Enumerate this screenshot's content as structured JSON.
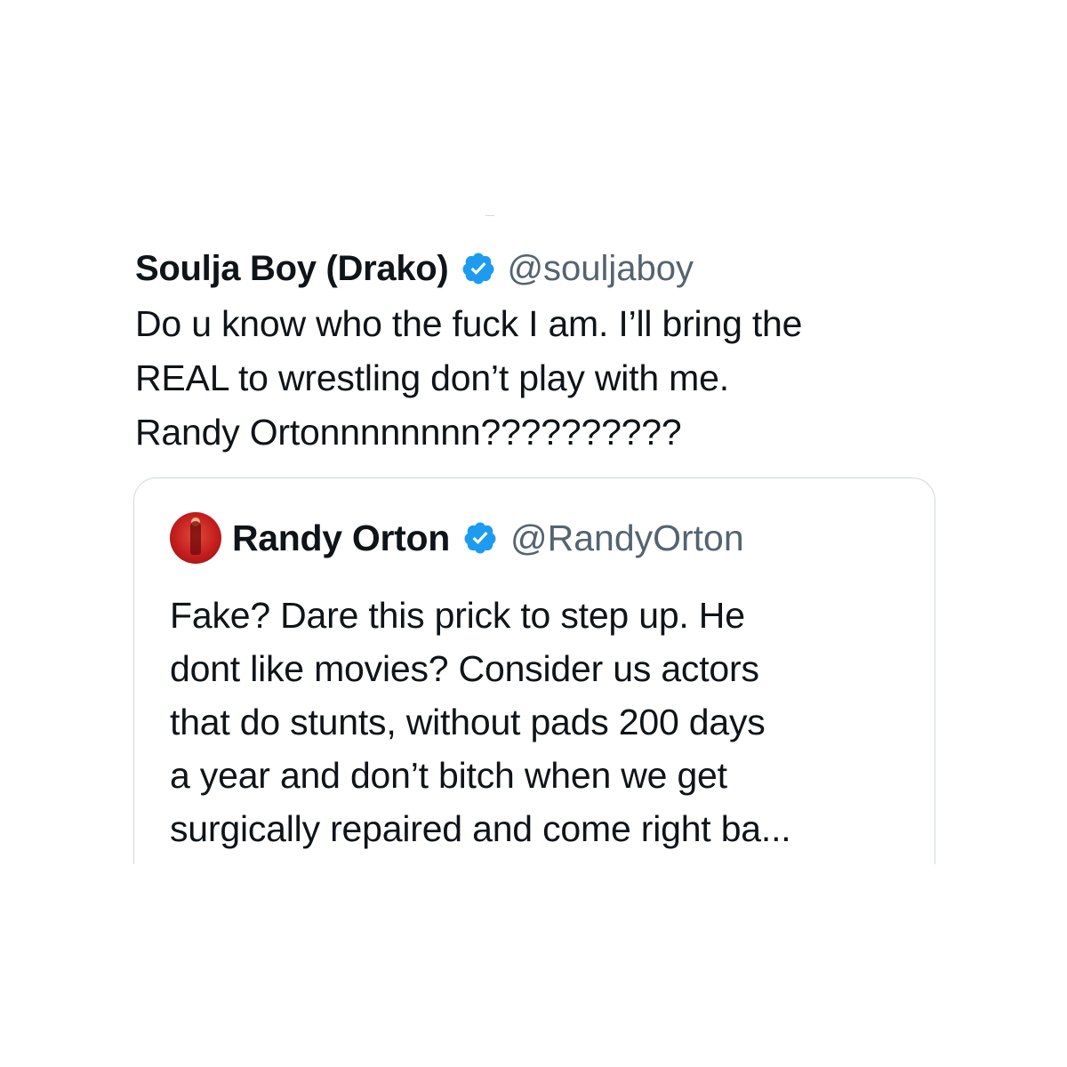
{
  "tweet": {
    "display_name": "Soulja Boy (Drako)",
    "handle": "@souljaboy",
    "verified": true,
    "text_lines": [
      "Do u know who the fuck I am. I’ll bring the",
      "REAL to wrestling don’t play with me.",
      "Randy Ortonnnnnnnn??????????"
    ]
  },
  "quoted_tweet": {
    "display_name": "Randy Orton",
    "handle": "@RandyOrton",
    "verified": true,
    "avatar_icon": "profile-avatar",
    "text_lines": [
      "Fake? Dare this prick to step up. He",
      "dont like movies? Consider us actors",
      "that do stunts, without pads 200 days",
      "a year and don’t bitch when we get",
      "surgically repaired and come right ba..."
    ]
  },
  "colors": {
    "verified_badge": "#1d9bf0",
    "handle_text": "#536471",
    "card_border": "#cfd9de",
    "avatar_background": "#c31e1e"
  }
}
